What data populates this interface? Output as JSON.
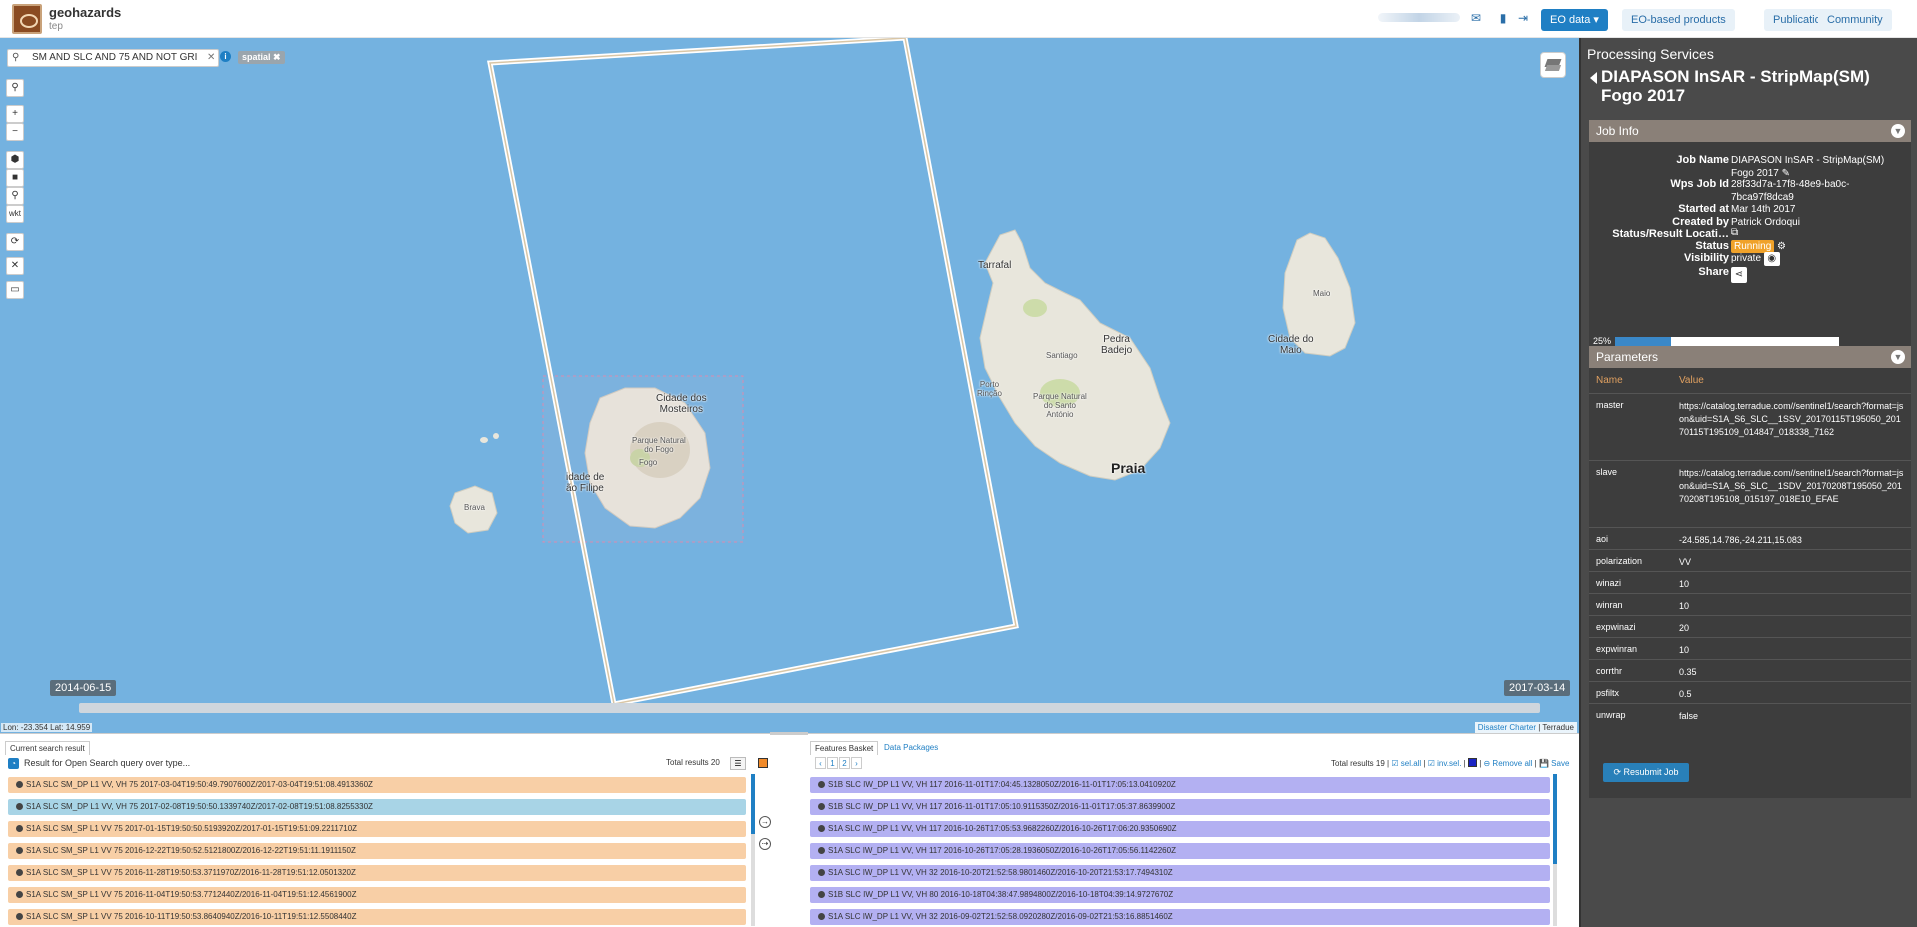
{
  "header": {
    "logo_name": "geohazards",
    "logo_sub": "tep",
    "nav_buttons": [
      "EO data ▾",
      "EO-based products",
      "Publications",
      "Community"
    ]
  },
  "map": {
    "search_text": "SM AND SLC AND 75 AND NOT GRI",
    "spatial_tag": "spatial ✖",
    "tools": [
      "⚲",
      "+",
      "−",
      "⬢",
      "■",
      "⚲",
      "wkt",
      "⟳",
      "✕",
      "▭"
    ],
    "places": {
      "tarrafal": "Tarrafal",
      "pedra_badejo": "Pedra\nBadejo",
      "santiago": "Santiago",
      "porto_rincao": "Porto\nRinção",
      "parque_santo": "Parque Natural\ndo Santo\nAntónio",
      "praia": "Praia",
      "maio": "Maio",
      "cidade_maio": "Cidade do\nMaio",
      "cidade_mosteiros": "Cidade dos\nMosteiros",
      "parque_fogo": "Parque Natural\ndo Fogo",
      "fogo": "Fogo",
      "sao_filipe": "idade de\não Filipe",
      "brava": "Brava"
    },
    "date_start": "2014-06-15",
    "date_end": "2017-03-14",
    "lonlat": "Lon: -23.354 Lat: 14.959",
    "attribution_link": "Disaster Charter",
    "attribution_sep": " | ",
    "attribution_other": "Terradue"
  },
  "panel": {
    "title": "Processing Services",
    "job_title": "DIAPASON InSAR - StripMap(SM) Fogo 2017",
    "job_info_head": "Job Info",
    "fields": [
      {
        "label": "Job Name",
        "value": "DIAPASON InSAR - StripMap(SM) Fogo 2017 ✎"
      },
      {
        "label": "Wps Job Id",
        "value": "28f33d7a-17f8-48e9-ba0c-7bca97f8dca9"
      },
      {
        "label": "Started at",
        "value": "Mar 14th 2017"
      },
      {
        "label": "Created by",
        "value": "Patrick Ordoqui"
      },
      {
        "label": "Status/Result Locati…",
        "value": "⧉"
      },
      {
        "label": "Status",
        "value": "Running"
      },
      {
        "label": "Visibility",
        "value": "private"
      },
      {
        "label": "Share",
        "value": ""
      }
    ],
    "progress": 0.25,
    "progress_label": "25%",
    "params_head": "Parameters",
    "params_col_name": "Name",
    "params_col_value": "Value",
    "params": [
      {
        "name": "master",
        "value": "https://catalog.terradue.com//sentinel1/search?format=json&uid=S1A_S6_SLC__1SSV_20170115T195050_20170115T195109_014847_018338_7162"
      },
      {
        "name": "slave",
        "value": "https://catalog.terradue.com//sentinel1/search?format=json&uid=S1A_S6_SLC__1SDV_20170208T195050_20170208T195108_015197_018E10_EFAE"
      },
      {
        "name": "aoi",
        "value": "-24.585,14.786,-24.211,15.083"
      },
      {
        "name": "polarization",
        "value": "VV"
      },
      {
        "name": "winazi",
        "value": "10"
      },
      {
        "name": "winran",
        "value": "10"
      },
      {
        "name": "expwinazi",
        "value": "20"
      },
      {
        "name": "expwinran",
        "value": "10"
      },
      {
        "name": "corrthr",
        "value": "0.35"
      },
      {
        "name": "psfiltx",
        "value": "0.5"
      },
      {
        "name": "unwrap",
        "value": "false"
      }
    ],
    "resubmit": "⟳ Resubmit Job"
  },
  "bottom": {
    "left_tab": "Current search result",
    "left_header": "Result for Open Search query over type...",
    "left_total": "Total results  20",
    "left_rows": [
      "S1A SLC SM_DP L1 VV, VH 75 2017-03-04T19:50:49.7907600Z/2017-03-04T19:51:08.4913360Z",
      "S1A SLC SM_DP L1 VV, VH 75 2017-02-08T19:50:50.1339740Z/2017-02-08T19:51:08.8255330Z",
      "S1A SLC SM_SP L1 VV 75 2017-01-15T19:50:50.5193920Z/2017-01-15T19:51:09.2211710Z",
      "S1A SLC SM_SP L1 VV 75 2016-12-22T19:50:52.5121800Z/2016-12-22T19:51:11.1911150Z",
      "S1A SLC SM_SP L1 VV 75 2016-11-28T19:50:53.3711970Z/2016-11-28T19:51:12.0501320Z",
      "S1A SLC SM_SP L1 VV 75 2016-11-04T19:50:53.7712440Z/2016-11-04T19:51:12.4561900Z",
      "S1A SLC SM_SP L1 VV 75 2016-10-11T19:50:53.8640940Z/2016-10-11T19:51:12.5508440Z"
    ],
    "right_tab_active": "Features Basket",
    "right_tab_other": "Data Packages",
    "pager": [
      "‹",
      "1",
      "2",
      "›"
    ],
    "right_total": "Total results  19  |",
    "sel_all": "☑ sel.all",
    "inv_sel": "☑ inv.sel.",
    "remove_all": "⊖ Remove all",
    "save": "💾 Save",
    "right_rows": [
      "S1B SLC IW_DP L1 VV, VH 117 2016-11-01T17:04:45.1328050Z/2016-11-01T17:05:13.0410920Z",
      "S1B SLC IW_DP L1 VV, VH 117 2016-11-01T17:05:10.9115350Z/2016-11-01T17:05:37.8639900Z",
      "S1A SLC IW_DP L1 VV, VH 117 2016-10-26T17:05:53.9682260Z/2016-10-26T17:06:20.9350690Z",
      "S1A SLC IW_DP L1 VV, VH 117 2016-10-26T17:05:28.1936050Z/2016-10-26T17:05:56.1142260Z",
      "S1A SLC IW_DP L1 VV, VH 32 2016-10-20T21:52:58.9801460Z/2016-10-20T21:53:17.7494310Z",
      "S1B SLC IW_DP L1 VV, VH 80 2016-10-18T04:38:47.9894800Z/2016-10-18T04:39:14.9727670Z",
      "S1A SLC IW_DP L1 VV, VH 32 2016-09-02T21:52:58.0920280Z/2016-09-02T21:53:16.8851460Z"
    ]
  }
}
